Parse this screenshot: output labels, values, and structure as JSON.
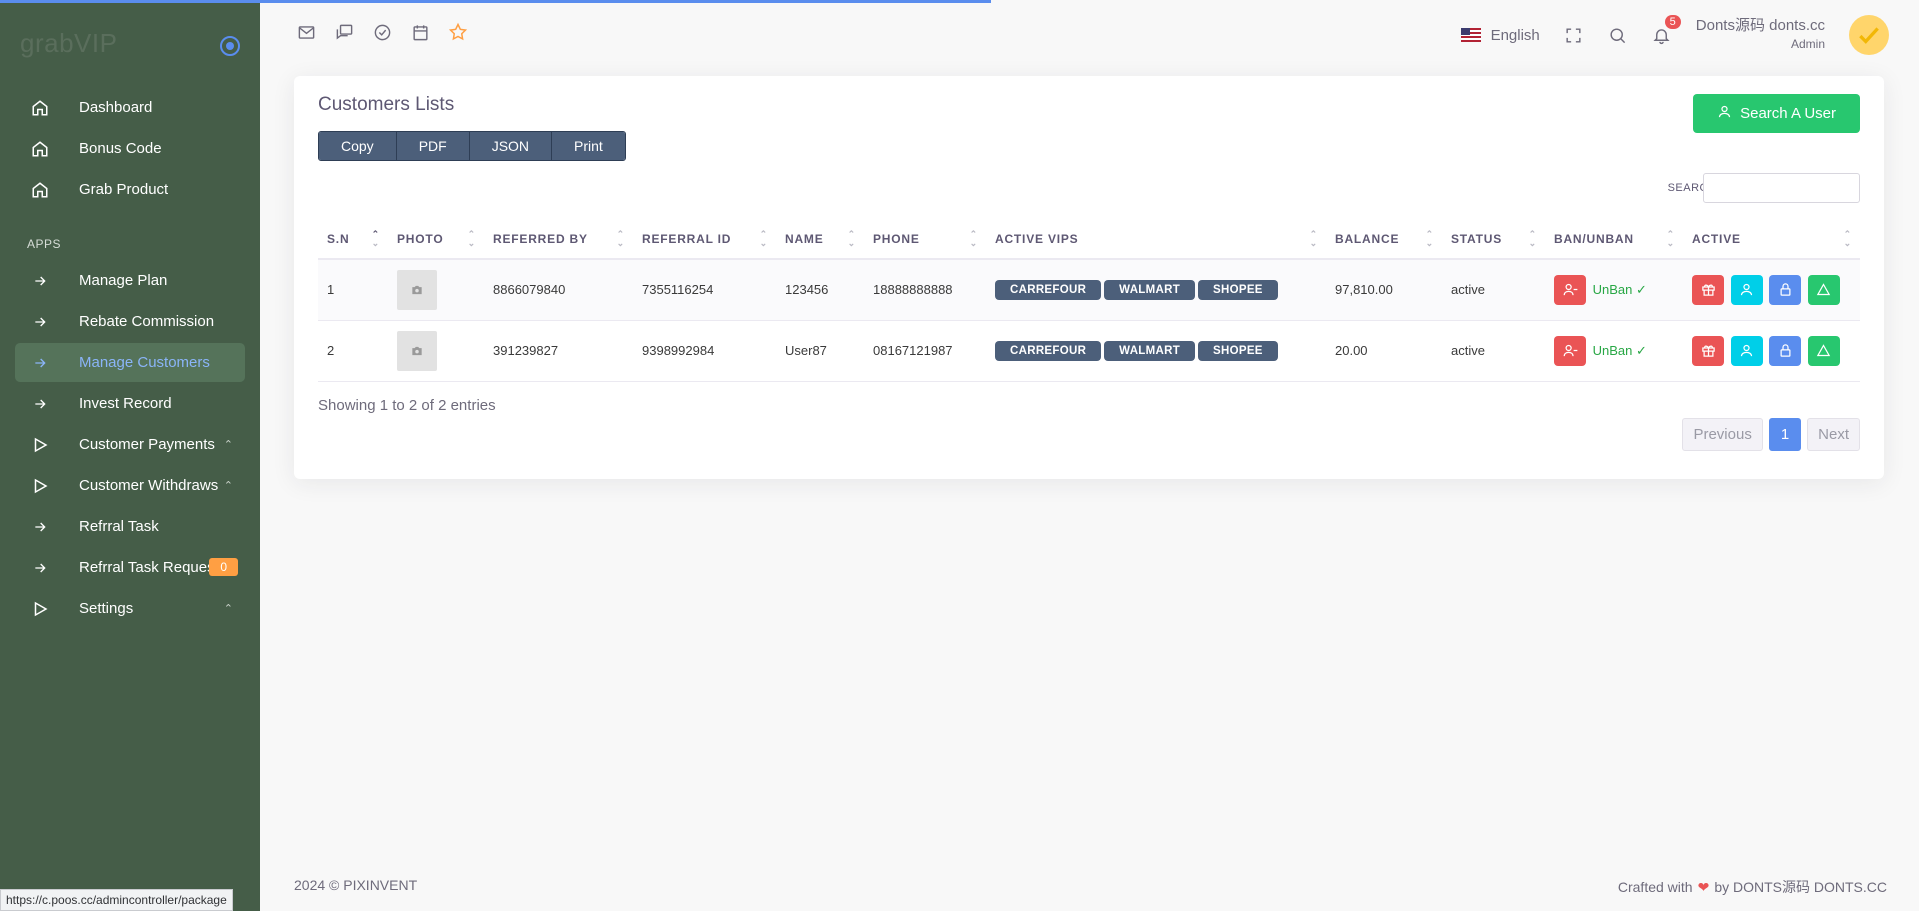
{
  "brand": {
    "name": "grabVIP"
  },
  "sidebar": {
    "items": [
      {
        "label": "Dashboard",
        "icon": "home-icon"
      },
      {
        "label": "Bonus Code",
        "icon": "home-icon"
      },
      {
        "label": "Grab Product",
        "icon": "home-icon"
      }
    ],
    "section_label": "APPS",
    "apps": [
      {
        "label": "Manage Plan",
        "icon": "arrow-right-icon"
      },
      {
        "label": "Rebate Commission",
        "icon": "arrow-right-icon"
      },
      {
        "label": "Manage Customers",
        "icon": "arrow-right-icon",
        "active": true
      },
      {
        "label": "Invest Record",
        "icon": "arrow-right-icon"
      },
      {
        "label": "Customer Payments",
        "icon": "play-icon"
      },
      {
        "label": "Customer Withdraws",
        "icon": "play-icon"
      },
      {
        "label": "Refrral Task",
        "icon": "arrow-right-icon"
      },
      {
        "label": "Refrral Task Request",
        "icon": "arrow-right-icon",
        "badge": "0"
      },
      {
        "label": "Settings",
        "icon": "play-icon"
      }
    ]
  },
  "header": {
    "language": "English",
    "notification_count": "5",
    "user_name": "Donts源码 donts.cc",
    "user_role": "Admin"
  },
  "card": {
    "title": "Customers Lists",
    "export_buttons": [
      "Copy",
      "PDF",
      "JSON",
      "Print"
    ],
    "search_user_label": "Search A User",
    "search_label": "SEARCH:",
    "search_value": ""
  },
  "table": {
    "columns": [
      "S.N",
      "PHOTO",
      "REFERRED BY",
      "REFERRAL ID",
      "NAME",
      "PHONE",
      "ACTIVE VIPS",
      "BALANCE",
      "STATUS",
      "BAN/UNBAN",
      "ACTIVE"
    ],
    "rows": [
      {
        "sn": "1",
        "referred_by": "8866079840",
        "referral_id": "7355116254",
        "name": "123456",
        "phone": "18888888888",
        "vips": [
          "CARREFOUR",
          "WALMART",
          "SHOPEE"
        ],
        "balance": "97,810.00",
        "status": "active",
        "ban_label": "UnBan"
      },
      {
        "sn": "2",
        "referred_by": "391239827",
        "referral_id": "9398992984",
        "name": "User87",
        "phone": "08167121987",
        "vips": [
          "CARREFOUR",
          "WALMART",
          "SHOPEE"
        ],
        "balance": "20.00",
        "status": "active",
        "ban_label": "UnBan"
      }
    ]
  },
  "pagination": {
    "info": "Showing 1 to 2 of 2 entries",
    "previous": "Previous",
    "current": "1",
    "next": "Next"
  },
  "footer": {
    "left": "2024 © PIXINVENT",
    "right_prefix": "Crafted with",
    "right_suffix": "by DONTS源码 DONTS.CC"
  },
  "status_url": "https://c.poos.cc/admincontroller/package",
  "colors": {
    "sidebar_bg": "#455d48",
    "accent": "#5a8dee",
    "success": "#28c76f",
    "danger": "#ea5455",
    "vip_badge": "#4c5f7a"
  }
}
